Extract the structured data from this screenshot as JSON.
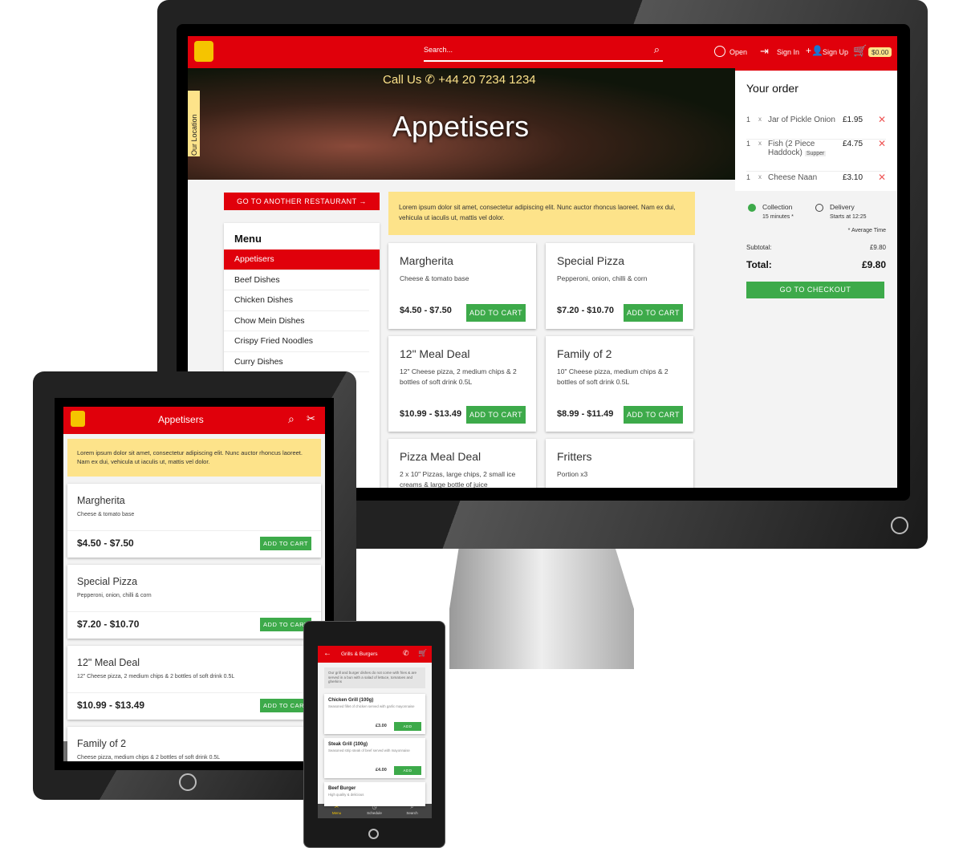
{
  "desktop": {
    "header": {
      "search_placeholder": "Search...",
      "open_label": "Open",
      "sign_in": "Sign In",
      "sign_up": "Sign Up",
      "cart_total": "$0.00"
    },
    "hero": {
      "call_us": "Call Us",
      "phone": "+44 20 7234 1234",
      "title": "Appetisers",
      "location_tab": "Our Location"
    },
    "another_restaurant": "GO TO ANOTHER RESTAURANT →",
    "menu": {
      "title": "Menu",
      "items": [
        "Appetisers",
        "Beef Dishes",
        "Chicken Dishes",
        "Chow Mein Dishes",
        "Crispy Fried Noodles",
        "Curry Dishes"
      ]
    },
    "notice": "Lorem ipsum dolor sit amet, consectetur adipiscing elit. Nunc auctor rhoncus laoreet. Nam ex dui, vehicula ut iaculis ut, mattis vel dolor.",
    "add_to_cart": "ADD TO CART",
    "products": [
      {
        "name": "Margherita",
        "desc": "Cheese & tomato base",
        "price": "$4.50 - $7.50"
      },
      {
        "name": "Special Pizza",
        "desc": "Pepperoni, onion, chilli & corn",
        "price": "$7.20 - $10.70"
      },
      {
        "name": "12\" Meal Deal",
        "desc": "12\" Cheese pizza, 2 medium chips & 2 bottles of soft drink 0.5L",
        "price": "$10.99 - $13.49"
      },
      {
        "name": "Family of 2",
        "desc": "10\" Cheese pizza, medium chips & 2 bottles of soft drink 0.5L",
        "price": "$8.99 - $11.49"
      },
      {
        "name": "Pizza Meal Deal",
        "desc": "2 x 10\" Pizzas, large chips, 2 small ice creams & large bottle of juice"
      },
      {
        "name": "Fritters",
        "desc": "Portion x3"
      }
    ],
    "order": {
      "title": "Your order",
      "items": [
        {
          "qty": "1",
          "x": "x",
          "name": "Jar of Pickle Onion",
          "price": "£1.95"
        },
        {
          "qty": "1",
          "x": "x",
          "name": "Fish (2 Piece Haddock)",
          "tag": "Supper",
          "price": "£4.75"
        },
        {
          "qty": "1",
          "x": "x",
          "name": "Cheese Naan",
          "price": "£3.10"
        }
      ],
      "collection": "Collection",
      "collection_time": "15 minutes *",
      "delivery": "Delivery",
      "delivery_time": "Starts at 12:25",
      "avg_note": "* Average Time",
      "subtotal_label": "Subtotal:",
      "subtotal": "£9.80",
      "total_label": "Total:",
      "total": "£9.80",
      "checkout": "GO TO CHECKOUT",
      "selected": "Collection"
    }
  },
  "tablet": {
    "title": "Appetisers",
    "notice": "Lorem ipsum dolor sit amet, consectetur adipiscing elit. Nunc auctor rhoncus laoreet. Nam ex dui, vehicula ut iaculis ut, mattis vel dolor.",
    "add_to_cart": "ADD TO CART",
    "products": [
      {
        "name": "Margherita",
        "desc": "Cheese & tomato base",
        "price": "$4.50 - $7.50"
      },
      {
        "name": "Special Pizza",
        "desc": "Pepperoni, onion, chilli & corn",
        "price": "$7.20 - $10.70"
      },
      {
        "name": "12\" Meal Deal",
        "desc": "12\" Cheese pizza, 2 medium chips & 2 bottles of soft drink 0.5L",
        "price": "$10.99 - $13.49"
      },
      {
        "name": "Family of 2",
        "desc": "Cheese pizza, medium chips & 2 bottles of soft drink 0.5L"
      }
    ]
  },
  "phone": {
    "title": "Grills & Burgers",
    "notice": "Our grill and burger dishes do not come with fries & are served in a bun with a salad of lettuce, tomatoes and gherkins",
    "add": "ADD",
    "products": [
      {
        "name": "Chicken Grill (100g)",
        "desc": "Seasoned fillet of chicken served with garlic mayonnaise",
        "price": "£3.00"
      },
      {
        "name": "Steak Grill (100g)",
        "desc": "Seasoned strip steak of beef served with mayonnaise",
        "price": "£4.00"
      },
      {
        "name": "Beef Burger",
        "desc": "High quality & delicious"
      }
    ],
    "nav": [
      "Menu",
      "Schedule",
      "Search"
    ]
  },
  "colors": {
    "brand_red": "#e0000b",
    "accent_green": "#3daa4a",
    "notice_yellow": "#fde38a"
  }
}
